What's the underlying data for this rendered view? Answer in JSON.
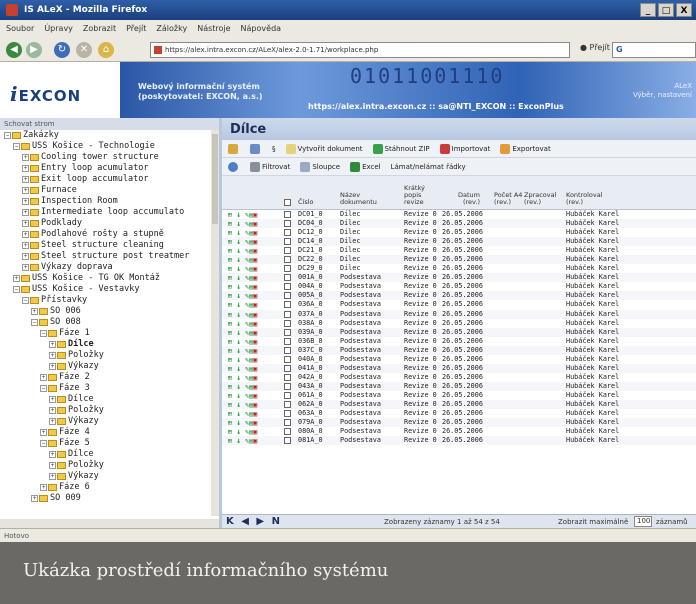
{
  "window": {
    "title": "IS ALeX - Mozilla Firefox",
    "buttons": [
      "_",
      "□",
      "X"
    ]
  },
  "menu": [
    "Soubor",
    "Úpravy",
    "Zobrazit",
    "Přejít",
    "Záložky",
    "Nástroje",
    "Nápověda"
  ],
  "nav": {
    "url": "https://alex.intra.excon.cz/ALeX/alex-2.0-1.71/workplace.php",
    "go_label": "Přejít",
    "search_value": "G"
  },
  "header": {
    "logo": "EXCON",
    "logo_i": "i",
    "app_title_1": "Webový informační systém",
    "app_title_2": "(poskytovatel: EXCON, a.s.)",
    "binary": "01011001110",
    "user_info": "https://alex.intra.excon.cz :: sa@NTI_EXCON :: ExconPlus",
    "side_1": "ALeX",
    "side_2": "Výběr, nastavení"
  },
  "tree": {
    "header": "Schovat strom",
    "items": [
      {
        "indent": 0,
        "exp": "−",
        "label": "Zakázky"
      },
      {
        "indent": 1,
        "exp": "−",
        "label": "USS Košice - Technologie"
      },
      {
        "indent": 2,
        "exp": "+",
        "label": "Cooling tower structure"
      },
      {
        "indent": 2,
        "exp": "+",
        "label": "Entry loop acumulator"
      },
      {
        "indent": 2,
        "exp": "+",
        "label": "Exit loop accumulator"
      },
      {
        "indent": 2,
        "exp": "+",
        "label": "Furnace"
      },
      {
        "indent": 2,
        "exp": "+",
        "label": "Inspection Room"
      },
      {
        "indent": 2,
        "exp": "+",
        "label": "Intermediate loop accumulato"
      },
      {
        "indent": 2,
        "exp": "+",
        "label": "Podklady"
      },
      {
        "indent": 2,
        "exp": "+",
        "label": "Podlahové rošty a stupně"
      },
      {
        "indent": 2,
        "exp": "+",
        "label": "Steel structure cleaning"
      },
      {
        "indent": 2,
        "exp": "+",
        "label": "Steel structure post treatmer"
      },
      {
        "indent": 2,
        "exp": "+",
        "label": "Výkazy doprava"
      },
      {
        "indent": 1,
        "exp": "+",
        "label": "USS Košice - TG OK Montáž"
      },
      {
        "indent": 1,
        "exp": "−",
        "label": "USS Košice - Vestavky"
      },
      {
        "indent": 2,
        "exp": "−",
        "label": "Přístavky"
      },
      {
        "indent": 3,
        "exp": "+",
        "label": "SO 006"
      },
      {
        "indent": 3,
        "exp": "−",
        "label": "SO 008"
      },
      {
        "indent": 4,
        "exp": "−",
        "label": "Fáze 1"
      },
      {
        "indent": 5,
        "exp": "+",
        "label": "Dílce",
        "bold": true
      },
      {
        "indent": 5,
        "exp": "+",
        "label": "Položky"
      },
      {
        "indent": 5,
        "exp": "+",
        "label": "Výkazy"
      },
      {
        "indent": 4,
        "exp": "+",
        "label": "Fáze 2"
      },
      {
        "indent": 4,
        "exp": "−",
        "label": "Fáze 3"
      },
      {
        "indent": 5,
        "exp": "+",
        "label": "Dílce"
      },
      {
        "indent": 5,
        "exp": "+",
        "label": "Položky"
      },
      {
        "indent": 5,
        "exp": "+",
        "label": "Výkazy"
      },
      {
        "indent": 4,
        "exp": "+",
        "label": "Fáze 4"
      },
      {
        "indent": 4,
        "exp": "−",
        "label": "Fáze 5"
      },
      {
        "indent": 5,
        "exp": "+",
        "label": "Dílce"
      },
      {
        "indent": 5,
        "exp": "+",
        "label": "Položky"
      },
      {
        "indent": 5,
        "exp": "+",
        "label": "Výkazy"
      },
      {
        "indent": 4,
        "exp": "+",
        "label": "Fáze 6"
      },
      {
        "indent": 3,
        "exp": "+",
        "label": "SO 009"
      }
    ]
  },
  "main": {
    "title": "Dílce",
    "toolbar1": [
      "§",
      "Vytvořit dokument",
      "Stáhnout ZIP",
      "Importovat",
      "Exportovat"
    ],
    "toolbar2": [
      "Filtrovat",
      "Sloupce",
      "Excel",
      "Lámat/nelámat řádky"
    ],
    "columns": [
      "Číslo",
      "Název dokumentu",
      "Krátký popis revize",
      "Datum (rev.)",
      "Počet A4 (rev.)",
      "Zpracoval (rev.)",
      "Kontroloval (rev.)"
    ],
    "rows": [
      [
        "DC01_0",
        "Dílec",
        "Revize 0",
        "26.05.2006",
        "Hubáček Karel"
      ],
      [
        "DC04_0",
        "Dílec",
        "Revize 0",
        "26.05.2006",
        "Hubáček Karel"
      ],
      [
        "DC12_0",
        "Dílec",
        "Revize 0",
        "26.05.2006",
        "Hubáček Karel"
      ],
      [
        "DC14_0",
        "Dílec",
        "Revize 0",
        "26.05.2006",
        "Hubáček Karel"
      ],
      [
        "DC21_0",
        "Dílec",
        "Revize 0",
        "26.05.2006",
        "Hubáček Karel"
      ],
      [
        "DC22_0",
        "Dílec",
        "Revize 0",
        "26.05.2006",
        "Hubáček Karel"
      ],
      [
        "DC29_0",
        "Dílec",
        "Revize 0",
        "26.05.2006",
        "Hubáček Karel"
      ],
      [
        "001A_0",
        "Podsestava",
        "Revize 0",
        "26.05.2006",
        "Hubáček Karel"
      ],
      [
        "004A_0",
        "Podsestava",
        "Revize 0",
        "26.05.2006",
        "Hubáček Karel"
      ],
      [
        "005A_0",
        "Podsestava",
        "Revize 0",
        "26.05.2006",
        "Hubáček Karel"
      ],
      [
        "036A_0",
        "Podsestava",
        "Revize 0",
        "26.05.2006",
        "Hubáček Karel"
      ],
      [
        "037A_0",
        "Podsestava",
        "Revize 0",
        "26.05.2006",
        "Hubáček Karel"
      ],
      [
        "038A_0",
        "Podsestava",
        "Revize 0",
        "26.05.2006",
        "Hubáček Karel"
      ],
      [
        "039A_0",
        "Podsestava",
        "Revize 0",
        "26.05.2006",
        "Hubáček Karel"
      ],
      [
        "036B_0",
        "Podsestava",
        "Revize 0",
        "26.05.2006",
        "Hubáček Karel"
      ],
      [
        "037C_0",
        "Podsestava",
        "Revize 0",
        "26.05.2006",
        "Hubáček Karel"
      ],
      [
        "040A_0",
        "Podsestava",
        "Revize 0",
        "26.05.2006",
        "Hubáček Karel"
      ],
      [
        "041A_0",
        "Podsestava",
        "Revize 0",
        "26.05.2006",
        "Hubáček Karel"
      ],
      [
        "042A_0",
        "Podsestava",
        "Revize 0",
        "26.05.2006",
        "Hubáček Karel"
      ],
      [
        "043A_0",
        "Podsestava",
        "Revize 0",
        "26.05.2006",
        "Hubáček Karel"
      ],
      [
        "061A_0",
        "Podsestava",
        "Revize 0",
        "26.05.2006",
        "Hubáček Karel"
      ],
      [
        "062A_0",
        "Podsestava",
        "Revize 0",
        "26.05.2006",
        "Hubáček Karel"
      ],
      [
        "063A_0",
        "Podsestava",
        "Revize 0",
        "26.05.2006",
        "Hubáček Karel"
      ],
      [
        "079A_0",
        "Podsestava",
        "Revize 0",
        "26.05.2006",
        "Hubáček Karel"
      ],
      [
        "080A_0",
        "Podsestava",
        "Revize 0",
        "26.05.2006",
        "Hubáček Karel"
      ],
      [
        "081A_0",
        "Podsestava",
        "Revize 0",
        "26.05.2006",
        "Hubáček Karel"
      ]
    ],
    "pager": "K ◀ ▶ N",
    "records": "Zobrazeny záznamy 1 až 54 z 54",
    "max_label": "Zobrazit maximálně",
    "max_value": "100",
    "records_cap": "záznamů"
  },
  "status": "Hotovo",
  "caption": "Ukázka prostředí informačního systému"
}
